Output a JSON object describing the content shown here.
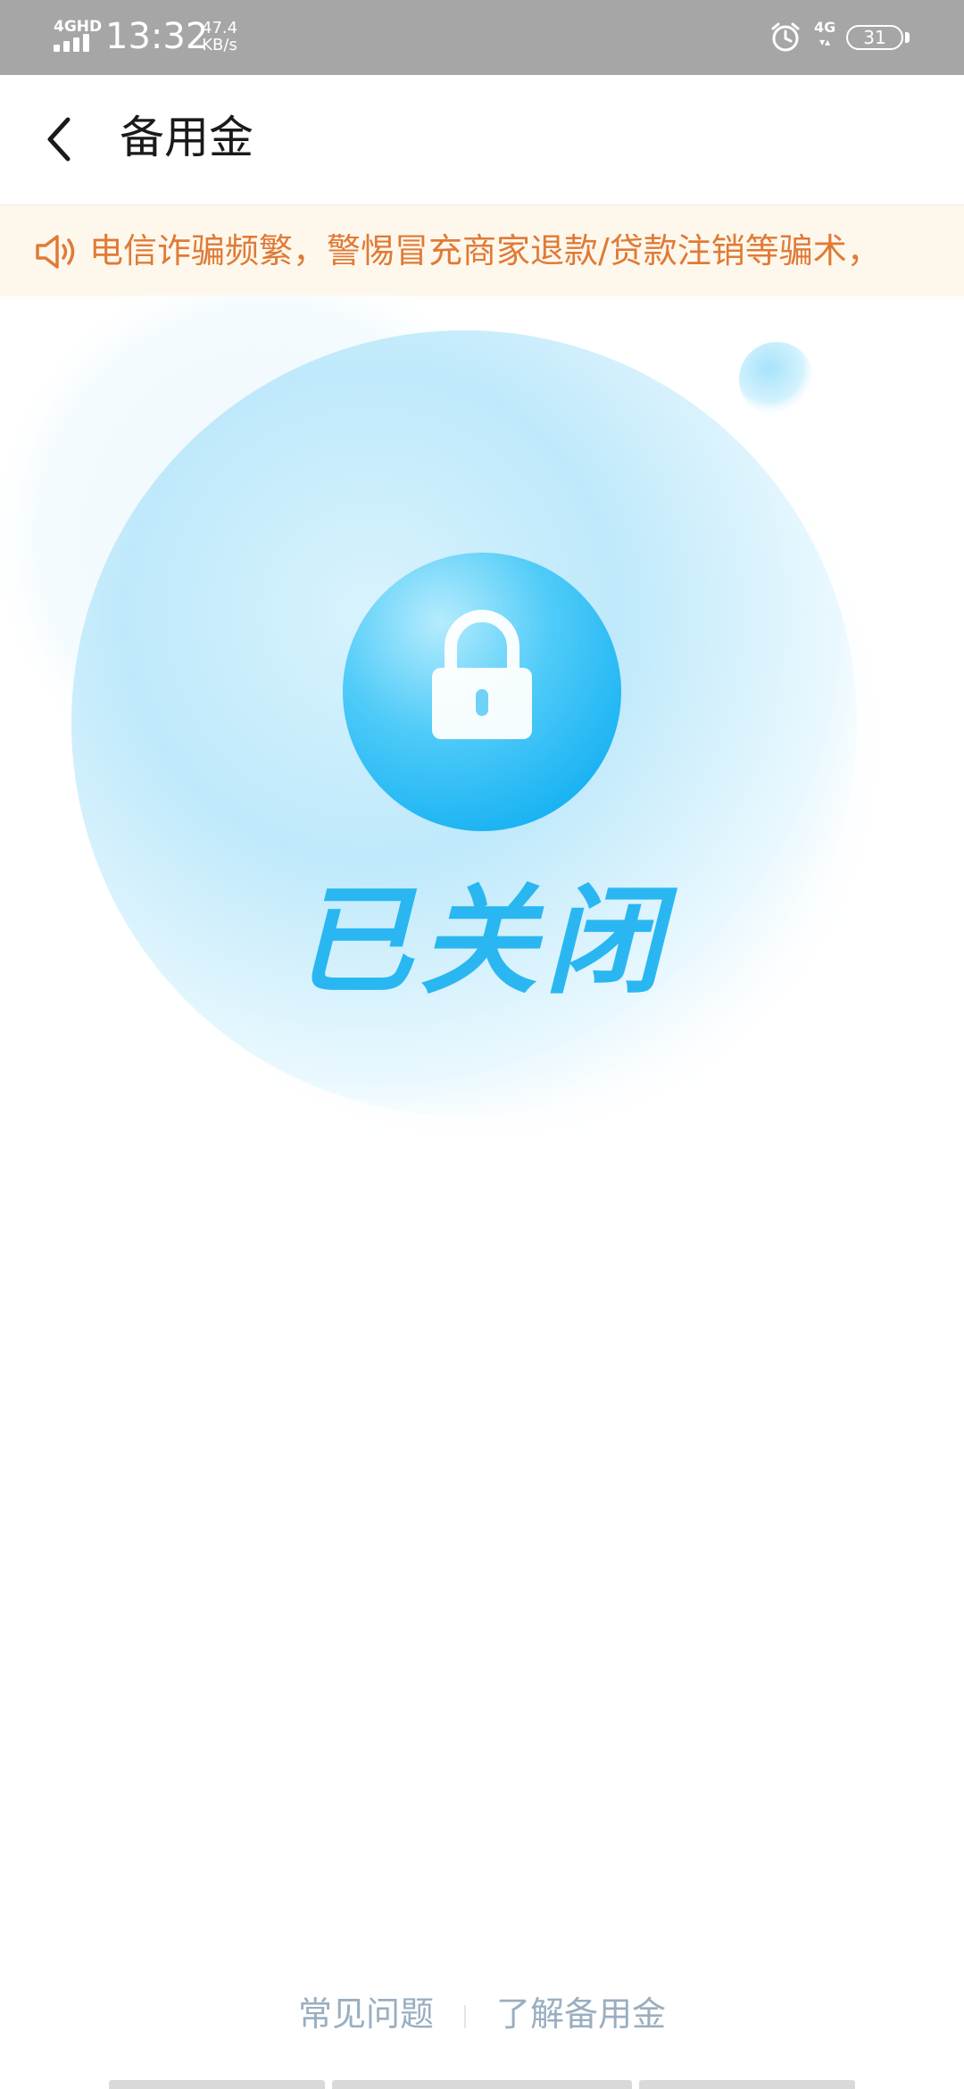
{
  "status_bar": {
    "network_type_left": "4GHD",
    "time": "13:32",
    "net_speed_value": "47.4",
    "net_speed_unit": "KB/s",
    "alarm_icon": "alarm-clock-icon",
    "network_type_right": "4G",
    "battery_level": "31"
  },
  "header": {
    "back_icon": "chevron-left-icon",
    "title": "备用金"
  },
  "notice": {
    "icon": "speaker-icon",
    "text": "电信诈骗频繁，警惕冒充商家退款/贷款注销等骗术，"
  },
  "hero": {
    "lock_icon": "lock-icon",
    "status_label": "已关闭",
    "accent_color": "#2ab7f1"
  },
  "footer": {
    "faq_label": "常见问题",
    "learn_more_label": "了解备用金"
  }
}
